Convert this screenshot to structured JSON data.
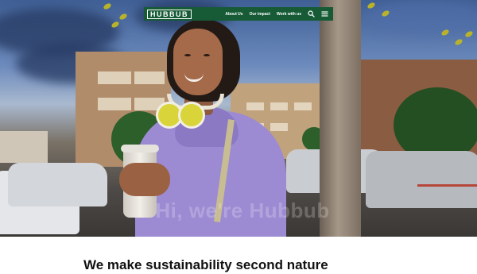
{
  "brand": {
    "logo_text": "HUBBUB",
    "nav_color": "#165b36"
  },
  "nav": {
    "links": [
      "About Us",
      "Our impact",
      "Work with us"
    ],
    "search_icon": "search-icon",
    "menu_icon": "hamburger-menu-icon"
  },
  "hero": {
    "watermark_text": "Hi, we're Hubbub"
  },
  "main": {
    "headline": "We make sustainability second nature"
  }
}
